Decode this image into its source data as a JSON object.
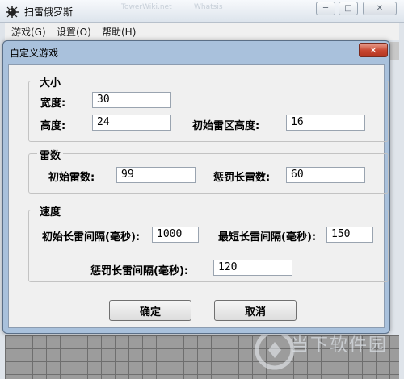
{
  "main_window": {
    "title": "扫雷俄罗斯",
    "ghost_texts": [
      "TowerWiki.net",
      "Whatsis"
    ],
    "controls": {
      "minimize": "─",
      "maximize": "□",
      "close": "✕"
    }
  },
  "menubar": {
    "items": [
      {
        "label": "游戏(G)"
      },
      {
        "label": "设置(O)"
      },
      {
        "label": "帮助(H)"
      }
    ]
  },
  "dialog": {
    "title": "自定义游戏",
    "close_glyph": "✕",
    "groups": {
      "size": {
        "label": "大小",
        "width_label": "宽度:",
        "width_value": "30",
        "height_label": "高度:",
        "height_value": "24",
        "mine_height_label": "初始雷区高度:",
        "mine_height_value": "16"
      },
      "mines": {
        "label": "雷数",
        "initial_label": "初始雷数:",
        "initial_value": "99",
        "penalty_label": "惩罚长雷数:",
        "penalty_value": "60"
      },
      "speed": {
        "label": "速度",
        "initial_interval_label": "初始长雷间隔(毫秒):",
        "initial_interval_value": "1000",
        "min_interval_label": "最短长雷间隔(毫秒):",
        "min_interval_value": "150",
        "penalty_interval_label": "惩罚长雷间隔(毫秒):",
        "penalty_interval_value": "120"
      }
    },
    "buttons": {
      "ok": "确定",
      "cancel": "取消"
    }
  },
  "watermark": {
    "text": "当下软件园"
  },
  "colors": {
    "dialog_frame": "#a9c1dc",
    "client_bg": "#f0f0f0",
    "close_red": "#c7452f",
    "board_gray": "#9c9c9c"
  }
}
